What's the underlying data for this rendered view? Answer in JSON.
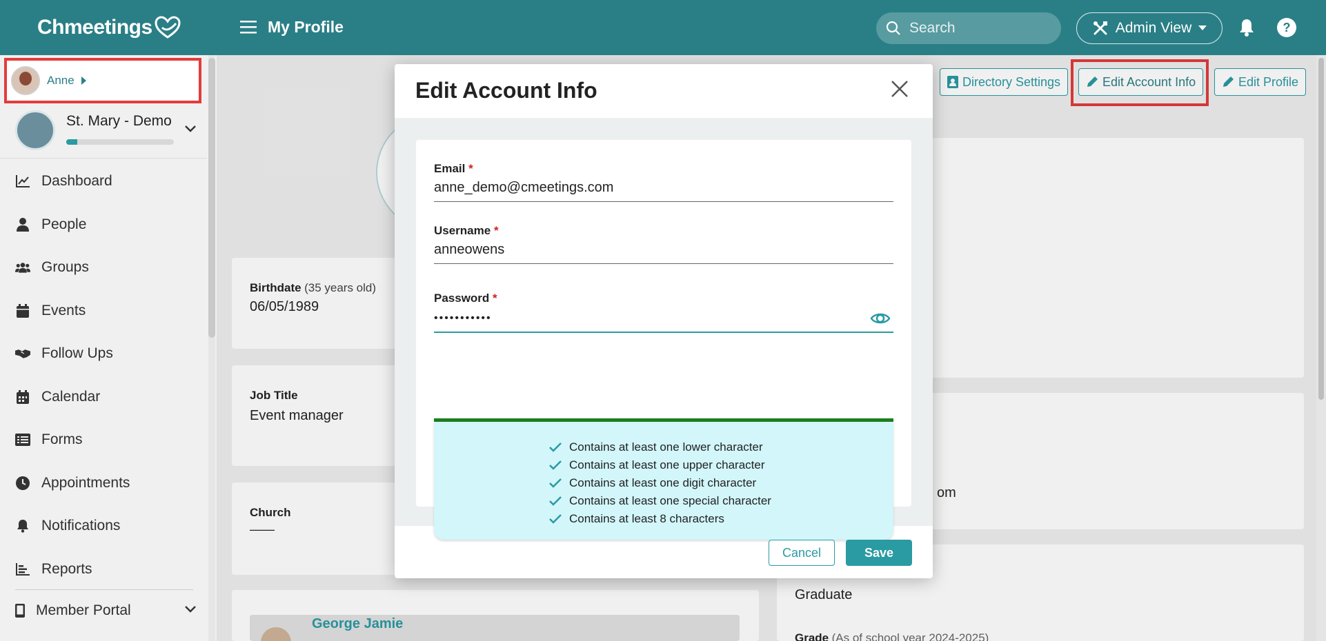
{
  "topbar": {
    "logo": "Chmeetings",
    "title": "My Profile",
    "search_placeholder": "Search",
    "admin_view_label": "Admin View"
  },
  "sidebar": {
    "user_name": "Anne",
    "church_name": "St. Mary - Demo",
    "church_progress": 0.1,
    "items": [
      {
        "label": "Dashboard",
        "icon": "chart-line-icon"
      },
      {
        "label": "People",
        "icon": "person-icon"
      },
      {
        "label": "Groups",
        "icon": "group-icon"
      },
      {
        "label": "Events",
        "icon": "calendar-icon"
      },
      {
        "label": "Follow Ups",
        "icon": "handshake-icon"
      },
      {
        "label": "Calendar",
        "icon": "calendar-grid-icon"
      },
      {
        "label": "Forms",
        "icon": "list-icon"
      },
      {
        "label": "Appointments",
        "icon": "clock-icon"
      },
      {
        "label": "Notifications",
        "icon": "bell-icon"
      },
      {
        "label": "Reports",
        "icon": "bar-chart-icon"
      }
    ],
    "member_portal_label": "Member Portal"
  },
  "profile_actions": {
    "directory_settings": "Directory Settings",
    "edit_account_info": "Edit Account Info",
    "edit_profile": "Edit Profile"
  },
  "profile": {
    "birthdate_label": "Birthdate",
    "birthdate_age": "(35 years old)",
    "birthdate_value": "06/05/1989",
    "job_title_label": "Job Title",
    "job_title_value": "Event manager",
    "church_label": "Church",
    "church_value": "——",
    "family_member_name": "George Jamie",
    "right_partial_email": "om",
    "education_value": "Graduate",
    "grade_label": "Grade",
    "grade_sub": "(As of school year 2024-2025)"
  },
  "modal": {
    "title": "Edit Account Info",
    "email_label": "Email",
    "email_value": "anne_demo@cmeetings.com",
    "username_label": "Username",
    "username_value": "anneowens",
    "password_label": "Password",
    "password_value": "•••••••••••",
    "required_mark": "*",
    "rules": [
      "Contains at least one lower character",
      "Contains at least one upper character",
      "Contains at least one digit character",
      "Contains at least one special character",
      "Contains at least 8 characters"
    ],
    "cancel_label": "Cancel",
    "save_label": "Save"
  },
  "colors": {
    "brand": "#2a7f86",
    "accent": "#2a9aa3",
    "highlight": "#e33b3b",
    "strength": "#1b7d1b",
    "rules_bg": "#d2f6fa"
  }
}
